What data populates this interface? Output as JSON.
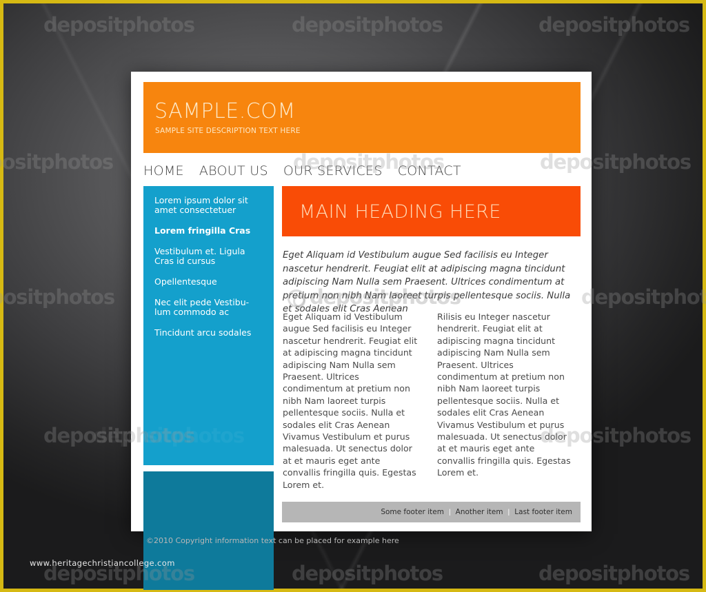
{
  "stock": {
    "frame_color": "#d6b913",
    "watermark_text": "depositphotos",
    "watermark_logo": "copyright-circle-icon",
    "site_url": "www.heritagechristiancollege.com"
  },
  "template": {
    "header": {
      "title": "SAMPLE.COM",
      "tagline": "SAMPLE SITE DESCRIPTION TEXT HERE",
      "background_color": "#f7850e"
    },
    "nav": {
      "items": [
        {
          "label": "HOME"
        },
        {
          "label": "ABOUT US"
        },
        {
          "label": "OUR SERVICES"
        },
        {
          "label": "CONTACT"
        }
      ]
    },
    "sidebar": {
      "background_color": "#14a0cc",
      "secondary_color": "#0e7a9b",
      "items": [
        {
          "label": "Lorem ipsum dolor sit amet consectetuer",
          "active": false
        },
        {
          "label": "Lorem fringilla Cras",
          "active": true
        },
        {
          "label": "Vestibulum et. Ligula Cras id cursus",
          "active": false
        },
        {
          "label": "Opellentesque",
          "active": false
        },
        {
          "label": "Nec elit pede Vestibu-lum commodo ac",
          "active": false
        },
        {
          "label": "Tincidunt arcu sodales",
          "active": false
        }
      ]
    },
    "main": {
      "heading": "MAIN HEADING HERE",
      "heading_color": "#f94c06",
      "intro": "Eget Aliquam id Vestibulum augue Sed facilisis eu Integer nascetur hendrerit. Feugiat elit at adipiscing magna tincidunt adipiscing Nam Nulla sem Praesent. Ultrices condimentum at pretium non nibh Nam laoreet turpis pellentesque sociis. Nulla et sodales elit Cras Aenean",
      "column_left": "Eget Aliquam id Vestibulum augue Sed facilisis eu Integer nascetur hendrerit. Feugiat elit at adipiscing magna tincidunt adipiscing Nam Nulla sem Praesent. Ultrices condimentum at pretium non nibh Nam laoreet turpis pellentesque sociis. Nulla et sodales elit Cras Aenean Vivamus Vestibulum et purus malesuada. Ut senectus dolor at et mauris eget ante convallis fringilla quis. Egestas Lorem et.",
      "column_right": "Rilisis eu Integer nascetur hendrerit. Feugiat elit at adipiscing magna tincidunt adipiscing Nam Nulla sem Praesent. Ultrices condimentum at pretium non nibh Nam laoreet turpis pellentesque sociis. Nulla et sodales elit Cras Aenean Vivamus Vestibulum et purus malesuada. Ut senectus dolor at et mauris eget ante convallis fringilla quis. Egestas Lorem et."
    },
    "footer": {
      "items": [
        {
          "label": "Some footer item"
        },
        {
          "label": "Another item"
        },
        {
          "label": "Last footer item"
        }
      ],
      "separator": "|",
      "background_color": "#b6b6b6"
    },
    "copyright": "©2010 Copyright information text can be placed for example here"
  }
}
